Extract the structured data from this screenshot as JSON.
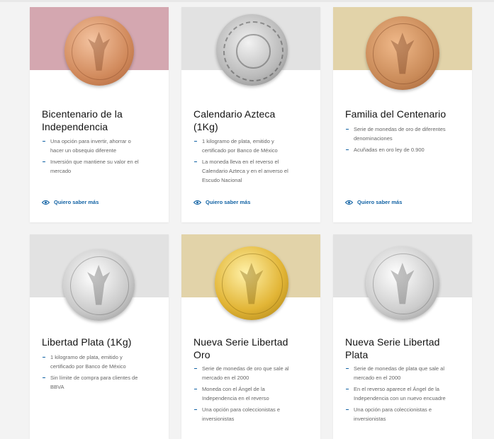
{
  "cards": [
    {
      "title_l1": "Bicentenario de la",
      "title_l2": "Independencia",
      "bullets": [
        {
          "l1": "Una opción para invertir, ahorrar o",
          "l2": "hacer un obsequio diferente"
        },
        {
          "l1": "Inversión que mantiene su valor en el",
          "l2": "mercado"
        }
      ],
      "link": "Quiero saber más",
      "bg": "#d4a7b0",
      "coin": "copper"
    },
    {
      "title_l1": "Calendario Azteca",
      "title_l2": "(1Kg)",
      "bullets": [
        {
          "l1": "1 kilogramo de plata, emitido y",
          "l2": "certificado por Banco de México"
        },
        {
          "l1": "La moneda lleva en el reverso el",
          "l2": "Calendario Azteca y en el anverso el",
          "l3": "Escudo Nacional"
        }
      ],
      "link": "Quiero saber más",
      "bg": "#e2e2e2",
      "coin": "aztec"
    },
    {
      "title_l1": "Familia del Centenario",
      "title_l2": "",
      "bullets": [
        {
          "l1": "Serie de monedas de oro de diferentes",
          "l2": "denominaciones"
        },
        {
          "l1": "Acuñadas en oro ley de 0.900",
          "l2": ""
        }
      ],
      "link": "Quiero saber más",
      "bg": "#e2d3a9",
      "coin": "centenario"
    },
    {
      "title_l1": "Libertad Plata (1Kg)",
      "title_l2": "",
      "bullets": [
        {
          "l1": "1 kilogramo de plata, emitido y",
          "l2": "certificado por Banco de México"
        },
        {
          "l1": "Sin límite de compra para clientes de",
          "l2": "BBVA"
        }
      ],
      "link": "",
      "bg": "#e2e2e2",
      "coin": "silver"
    },
    {
      "title_l1": "Nueva Serie Libertad",
      "title_l2": "Oro",
      "bullets": [
        {
          "l1": "Serie de monedas de oro que sale al",
          "l2": "mercado en el  2000"
        },
        {
          "l1": "Moneda con el Ángel de la",
          "l2": "Independencia en el reverso"
        },
        {
          "l1": "Una opción para coleccionistas e",
          "l2": "inversionistas"
        }
      ],
      "link": "",
      "bg": "#e2d3a9",
      "coin": "gold"
    },
    {
      "title_l1": "Nueva Serie Libertad",
      "title_l2": "Plata",
      "bullets": [
        {
          "l1": "Serie de monedas de plata que sale al",
          "l2": "mercado en el 2000"
        },
        {
          "l1": "En el reverso aparece el Ángel de la",
          "l2": "Independencia con un nuevo encuadre"
        },
        {
          "l1": "Una opción para coleccionistas e",
          "l2": "inversionistas"
        }
      ],
      "link": "",
      "bg": "#e2e2e2",
      "coin": "silver"
    }
  ],
  "colors": {
    "accent": "#1464a5",
    "text": "#121212",
    "muted": "#666666"
  },
  "icons": {
    "link": "eye-icon",
    "bullet": "dash-bullet"
  }
}
